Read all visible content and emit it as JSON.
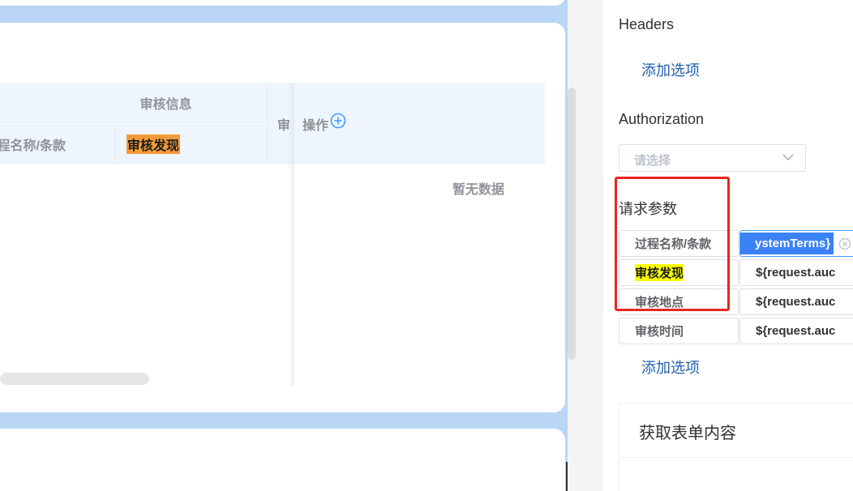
{
  "table": {
    "group_header": "审核信息",
    "col1_header": "程名称/条款",
    "col2_header": "审核发现",
    "col3_header": "审",
    "operation_header": "操作",
    "empty_text": "暂无数据"
  },
  "panel": {
    "headers_title": "Headers",
    "headers_add": "添加选项",
    "auth_title": "Authorization",
    "auth_placeholder": "请选择",
    "params_title": "请求参数",
    "params": [
      {
        "key": "过程名称/条款",
        "value": "ystemTerms}"
      },
      {
        "key": "审核发现",
        "value": "${request.auc"
      },
      {
        "key": "审核地点",
        "value": "${request.auc"
      },
      {
        "key": "审核时间",
        "value": "${request.auc"
      }
    ],
    "params_add": "添加选项",
    "form_card_title": "获取表单内容"
  },
  "colors": {
    "accent": "#409eff",
    "link": "#1f5fb0",
    "highlight_orange": "#f39a38",
    "highlight_yellow": "#fbff00",
    "annotation_red": "#e8261f",
    "canvas_blue": "#b9d6f6"
  }
}
